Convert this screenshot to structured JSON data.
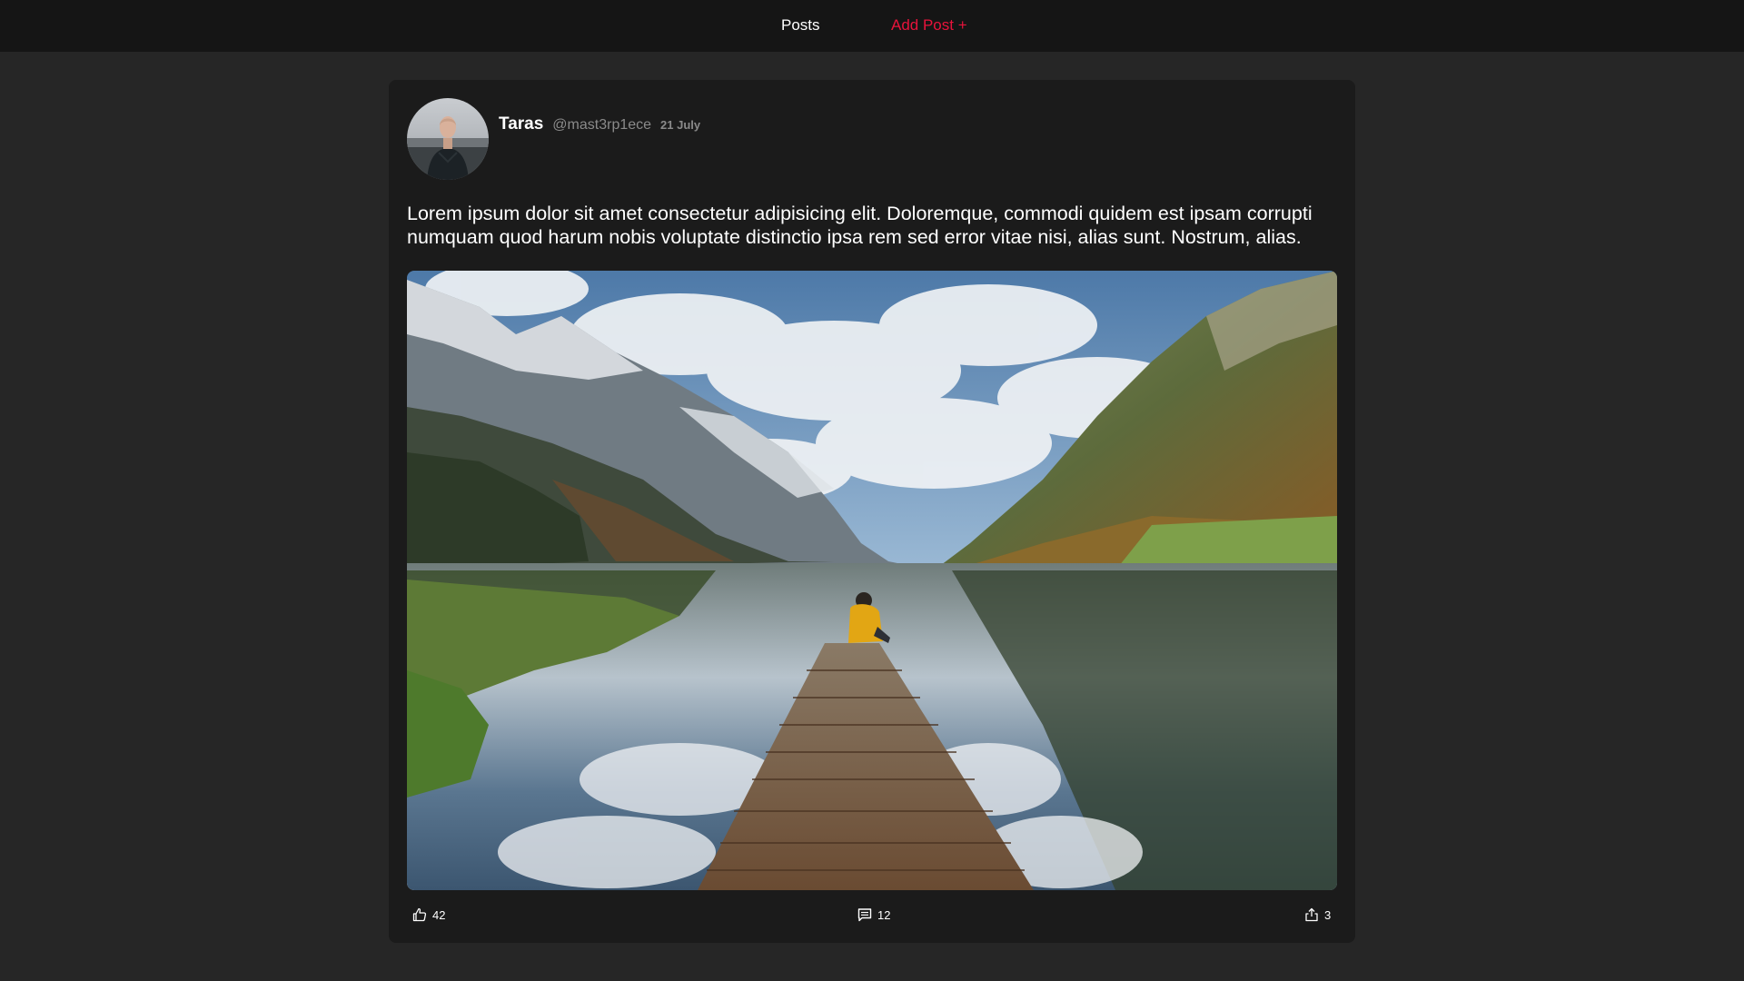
{
  "nav": {
    "posts_label": "Posts",
    "add_post_label": "Add Post +"
  },
  "post": {
    "author_name": "Taras",
    "author_handle": "@mast3rp1ece",
    "date": "21 July",
    "text": "Lorem ipsum dolor sit amet consectetur adipisicing elit. Doloremque, commodi quidem est ipsam corrupti numquam quod harum nobis voluptate distinctio ipsa rem sed error vitae nisi, alias sunt. Nostrum, alias.",
    "image_alt": "Person in yellow jacket sitting on a wooden pier at a mountain lake",
    "actions": {
      "likes": "42",
      "comments": "12",
      "shares": "3"
    }
  },
  "icons": {
    "like": "thumbs-up-icon",
    "comment": "comment-icon",
    "share": "share-icon"
  },
  "colors": {
    "background": "#262626",
    "topbar": "#151515",
    "card": "#1b1b1b",
    "accent": "#e8133b",
    "muted_text": "#8a8a8a"
  }
}
